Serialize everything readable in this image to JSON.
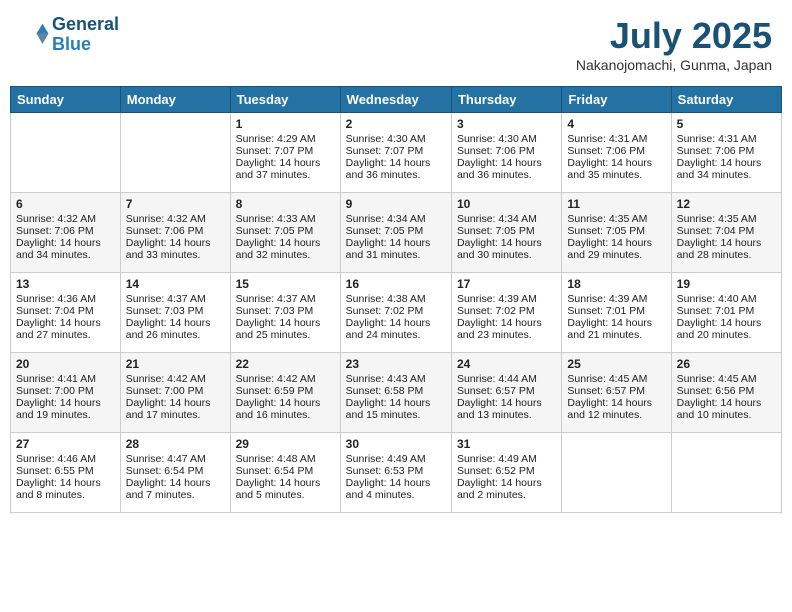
{
  "header": {
    "logo_line1": "General",
    "logo_line2": "Blue",
    "month_title": "July 2025",
    "subtitle": "Nakanojomachi, Gunma, Japan"
  },
  "weekdays": [
    "Sunday",
    "Monday",
    "Tuesday",
    "Wednesday",
    "Thursday",
    "Friday",
    "Saturday"
  ],
  "weeks": [
    [
      {
        "day": "",
        "sunrise": "",
        "sunset": "",
        "daylight": ""
      },
      {
        "day": "",
        "sunrise": "",
        "sunset": "",
        "daylight": ""
      },
      {
        "day": "1",
        "sunrise": "Sunrise: 4:29 AM",
        "sunset": "Sunset: 7:07 PM",
        "daylight": "Daylight: 14 hours and 37 minutes."
      },
      {
        "day": "2",
        "sunrise": "Sunrise: 4:30 AM",
        "sunset": "Sunset: 7:07 PM",
        "daylight": "Daylight: 14 hours and 36 minutes."
      },
      {
        "day": "3",
        "sunrise": "Sunrise: 4:30 AM",
        "sunset": "Sunset: 7:06 PM",
        "daylight": "Daylight: 14 hours and 36 minutes."
      },
      {
        "day": "4",
        "sunrise": "Sunrise: 4:31 AM",
        "sunset": "Sunset: 7:06 PM",
        "daylight": "Daylight: 14 hours and 35 minutes."
      },
      {
        "day": "5",
        "sunrise": "Sunrise: 4:31 AM",
        "sunset": "Sunset: 7:06 PM",
        "daylight": "Daylight: 14 hours and 34 minutes."
      }
    ],
    [
      {
        "day": "6",
        "sunrise": "Sunrise: 4:32 AM",
        "sunset": "Sunset: 7:06 PM",
        "daylight": "Daylight: 14 hours and 34 minutes."
      },
      {
        "day": "7",
        "sunrise": "Sunrise: 4:32 AM",
        "sunset": "Sunset: 7:06 PM",
        "daylight": "Daylight: 14 hours and 33 minutes."
      },
      {
        "day": "8",
        "sunrise": "Sunrise: 4:33 AM",
        "sunset": "Sunset: 7:05 PM",
        "daylight": "Daylight: 14 hours and 32 minutes."
      },
      {
        "day": "9",
        "sunrise": "Sunrise: 4:34 AM",
        "sunset": "Sunset: 7:05 PM",
        "daylight": "Daylight: 14 hours and 31 minutes."
      },
      {
        "day": "10",
        "sunrise": "Sunrise: 4:34 AM",
        "sunset": "Sunset: 7:05 PM",
        "daylight": "Daylight: 14 hours and 30 minutes."
      },
      {
        "day": "11",
        "sunrise": "Sunrise: 4:35 AM",
        "sunset": "Sunset: 7:05 PM",
        "daylight": "Daylight: 14 hours and 29 minutes."
      },
      {
        "day": "12",
        "sunrise": "Sunrise: 4:35 AM",
        "sunset": "Sunset: 7:04 PM",
        "daylight": "Daylight: 14 hours and 28 minutes."
      }
    ],
    [
      {
        "day": "13",
        "sunrise": "Sunrise: 4:36 AM",
        "sunset": "Sunset: 7:04 PM",
        "daylight": "Daylight: 14 hours and 27 minutes."
      },
      {
        "day": "14",
        "sunrise": "Sunrise: 4:37 AM",
        "sunset": "Sunset: 7:03 PM",
        "daylight": "Daylight: 14 hours and 26 minutes."
      },
      {
        "day": "15",
        "sunrise": "Sunrise: 4:37 AM",
        "sunset": "Sunset: 7:03 PM",
        "daylight": "Daylight: 14 hours and 25 minutes."
      },
      {
        "day": "16",
        "sunrise": "Sunrise: 4:38 AM",
        "sunset": "Sunset: 7:02 PM",
        "daylight": "Daylight: 14 hours and 24 minutes."
      },
      {
        "day": "17",
        "sunrise": "Sunrise: 4:39 AM",
        "sunset": "Sunset: 7:02 PM",
        "daylight": "Daylight: 14 hours and 23 minutes."
      },
      {
        "day": "18",
        "sunrise": "Sunrise: 4:39 AM",
        "sunset": "Sunset: 7:01 PM",
        "daylight": "Daylight: 14 hours and 21 minutes."
      },
      {
        "day": "19",
        "sunrise": "Sunrise: 4:40 AM",
        "sunset": "Sunset: 7:01 PM",
        "daylight": "Daylight: 14 hours and 20 minutes."
      }
    ],
    [
      {
        "day": "20",
        "sunrise": "Sunrise: 4:41 AM",
        "sunset": "Sunset: 7:00 PM",
        "daylight": "Daylight: 14 hours and 19 minutes."
      },
      {
        "day": "21",
        "sunrise": "Sunrise: 4:42 AM",
        "sunset": "Sunset: 7:00 PM",
        "daylight": "Daylight: 14 hours and 17 minutes."
      },
      {
        "day": "22",
        "sunrise": "Sunrise: 4:42 AM",
        "sunset": "Sunset: 6:59 PM",
        "daylight": "Daylight: 14 hours and 16 minutes."
      },
      {
        "day": "23",
        "sunrise": "Sunrise: 4:43 AM",
        "sunset": "Sunset: 6:58 PM",
        "daylight": "Daylight: 14 hours and 15 minutes."
      },
      {
        "day": "24",
        "sunrise": "Sunrise: 4:44 AM",
        "sunset": "Sunset: 6:57 PM",
        "daylight": "Daylight: 14 hours and 13 minutes."
      },
      {
        "day": "25",
        "sunrise": "Sunrise: 4:45 AM",
        "sunset": "Sunset: 6:57 PM",
        "daylight": "Daylight: 14 hours and 12 minutes."
      },
      {
        "day": "26",
        "sunrise": "Sunrise: 4:45 AM",
        "sunset": "Sunset: 6:56 PM",
        "daylight": "Daylight: 14 hours and 10 minutes."
      }
    ],
    [
      {
        "day": "27",
        "sunrise": "Sunrise: 4:46 AM",
        "sunset": "Sunset: 6:55 PM",
        "daylight": "Daylight: 14 hours and 8 minutes."
      },
      {
        "day": "28",
        "sunrise": "Sunrise: 4:47 AM",
        "sunset": "Sunset: 6:54 PM",
        "daylight": "Daylight: 14 hours and 7 minutes."
      },
      {
        "day": "29",
        "sunrise": "Sunrise: 4:48 AM",
        "sunset": "Sunset: 6:54 PM",
        "daylight": "Daylight: 14 hours and 5 minutes."
      },
      {
        "day": "30",
        "sunrise": "Sunrise: 4:49 AM",
        "sunset": "Sunset: 6:53 PM",
        "daylight": "Daylight: 14 hours and 4 minutes."
      },
      {
        "day": "31",
        "sunrise": "Sunrise: 4:49 AM",
        "sunset": "Sunset: 6:52 PM",
        "daylight": "Daylight: 14 hours and 2 minutes."
      },
      {
        "day": "",
        "sunrise": "",
        "sunset": "",
        "daylight": ""
      },
      {
        "day": "",
        "sunrise": "",
        "sunset": "",
        "daylight": ""
      }
    ]
  ]
}
